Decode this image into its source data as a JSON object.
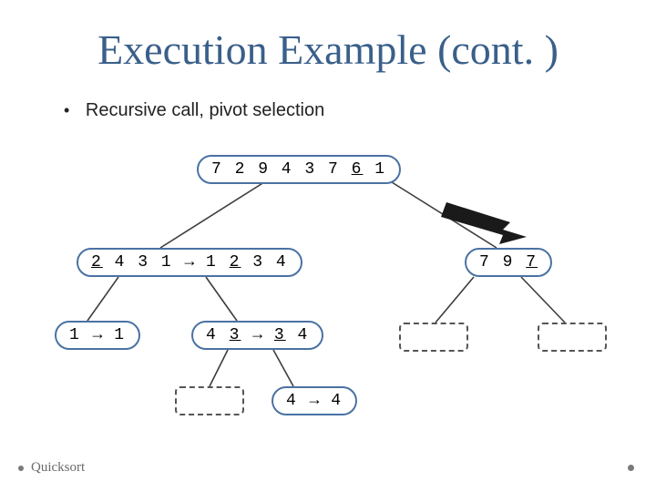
{
  "title": "Execution Example (cont. )",
  "bullet": "Recursive call, pivot selection",
  "nodes": {
    "root": {
      "tokens": [
        "7",
        "2",
        "9",
        "4",
        "3",
        "7",
        "6",
        "1"
      ],
      "pivot_index": 6
    },
    "left1": {
      "before": [
        "2",
        "4",
        "3",
        "1"
      ],
      "pivot_before": 0,
      "after": [
        "1",
        "2",
        "3",
        "4"
      ],
      "pivot_after": 1
    },
    "right1": {
      "tokens": [
        "7",
        "9",
        "7"
      ],
      "pivot_index": 2
    },
    "leaf11": {
      "before": [
        "1"
      ],
      "after": [
        "1"
      ]
    },
    "leaf12": {
      "before": [
        "4",
        "3"
      ],
      "pivot_before": 1,
      "after": [
        "3",
        "4"
      ],
      "pivot_after": 0
    },
    "leaf_deep": {
      "before": [
        "4"
      ],
      "after": [
        "4"
      ]
    }
  },
  "footer": "Quicksort"
}
